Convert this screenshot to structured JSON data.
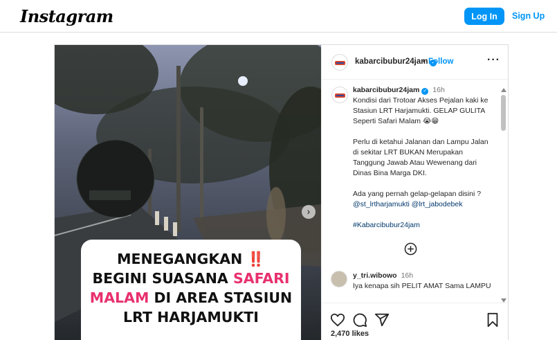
{
  "topbar": {
    "logo_text": "Instagram",
    "login_label": "Log In",
    "signup_label": "Sign Up"
  },
  "post": {
    "author": "kabarcibubur24jam",
    "separator": "•",
    "follow_label": "Follow",
    "more_icon": "more-horizontal-icon",
    "image_caption": {
      "line1_text": "MENEGANGKAN",
      "line1_emoji": "‼️",
      "line2_text": "BEGINI SUASANA",
      "line2_highlight": "SAFARI",
      "line3_highlight": "MALAM",
      "line3_text": "DI AREA STASIUN",
      "line4_text": "LRT HARJAMUKTI"
    },
    "caption": {
      "username": "kabarcibubur24jam",
      "time": "16h",
      "para1": "Kondisi dari Trotoar Akses Pejalan kaki ke Stasiun LRT Harjamukti. GELAP GULITA Seperti Safari Malam 😭😁",
      "para2": "Perlu di ketahui Jalanan dan Lampu Jalan di sekitar LRT BUKAN Merupakan Tanggung Jawab Atau Wewenang dari Dinas Bina Marga DKI.",
      "para3": "Ada yang pernah gelap-gelapan disini ?",
      "mention1": "@st_lrtharjamukti",
      "mention2": "@lrt_jabodebek",
      "hashtag": "#Kabarcibubur24jam"
    },
    "comments": [
      {
        "username": "y_tri.wibowo",
        "time": "16h",
        "text": "Iya kenapa sih PELIT AMAT Sama LAMPU"
      }
    ],
    "likes_text": "2,470 likes"
  },
  "colors": {
    "brand_blue": "#0095f6",
    "highlight_pink": "#e8306e",
    "border": "#dbdbdb"
  }
}
